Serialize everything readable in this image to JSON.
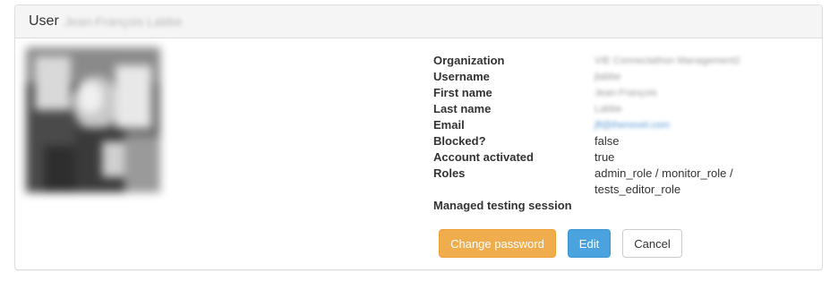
{
  "panel": {
    "title": "User",
    "title_name": "Jean-François Labbe"
  },
  "avatar": {
    "alt": "user avatar (blurred)"
  },
  "details": [
    {
      "label": "Organization",
      "value": "VIE Connectathon Management2",
      "blurred": true,
      "link": false
    },
    {
      "label": "Username",
      "value": "jlabbe",
      "blurred": true,
      "link": false
    },
    {
      "label": "First name",
      "value": "Jean-François",
      "blurred": true,
      "link": false
    },
    {
      "label": "Last name",
      "value": "Labbe",
      "blurred": true,
      "link": false
    },
    {
      "label": "Email",
      "value": "jfl@ihenovel.com",
      "blurred": true,
      "link": true
    },
    {
      "label": "Blocked?",
      "value": "false",
      "blurred": false,
      "link": false
    },
    {
      "label": "Account activated",
      "value": "true",
      "blurred": false,
      "link": false
    },
    {
      "label": "Roles",
      "value": "admin_role / monitor_role / tests_editor_role",
      "blurred": false,
      "link": false
    },
    {
      "label": "Managed testing session",
      "value": "",
      "blurred": false,
      "link": false
    }
  ],
  "buttons": {
    "change_password": "Change password",
    "edit": "Edit",
    "cancel": "Cancel"
  },
  "colors": {
    "warning": "#f0ad4e",
    "primary": "#4aa3df",
    "heading_bg": "#f5f5f5",
    "border": "#dddddd"
  }
}
